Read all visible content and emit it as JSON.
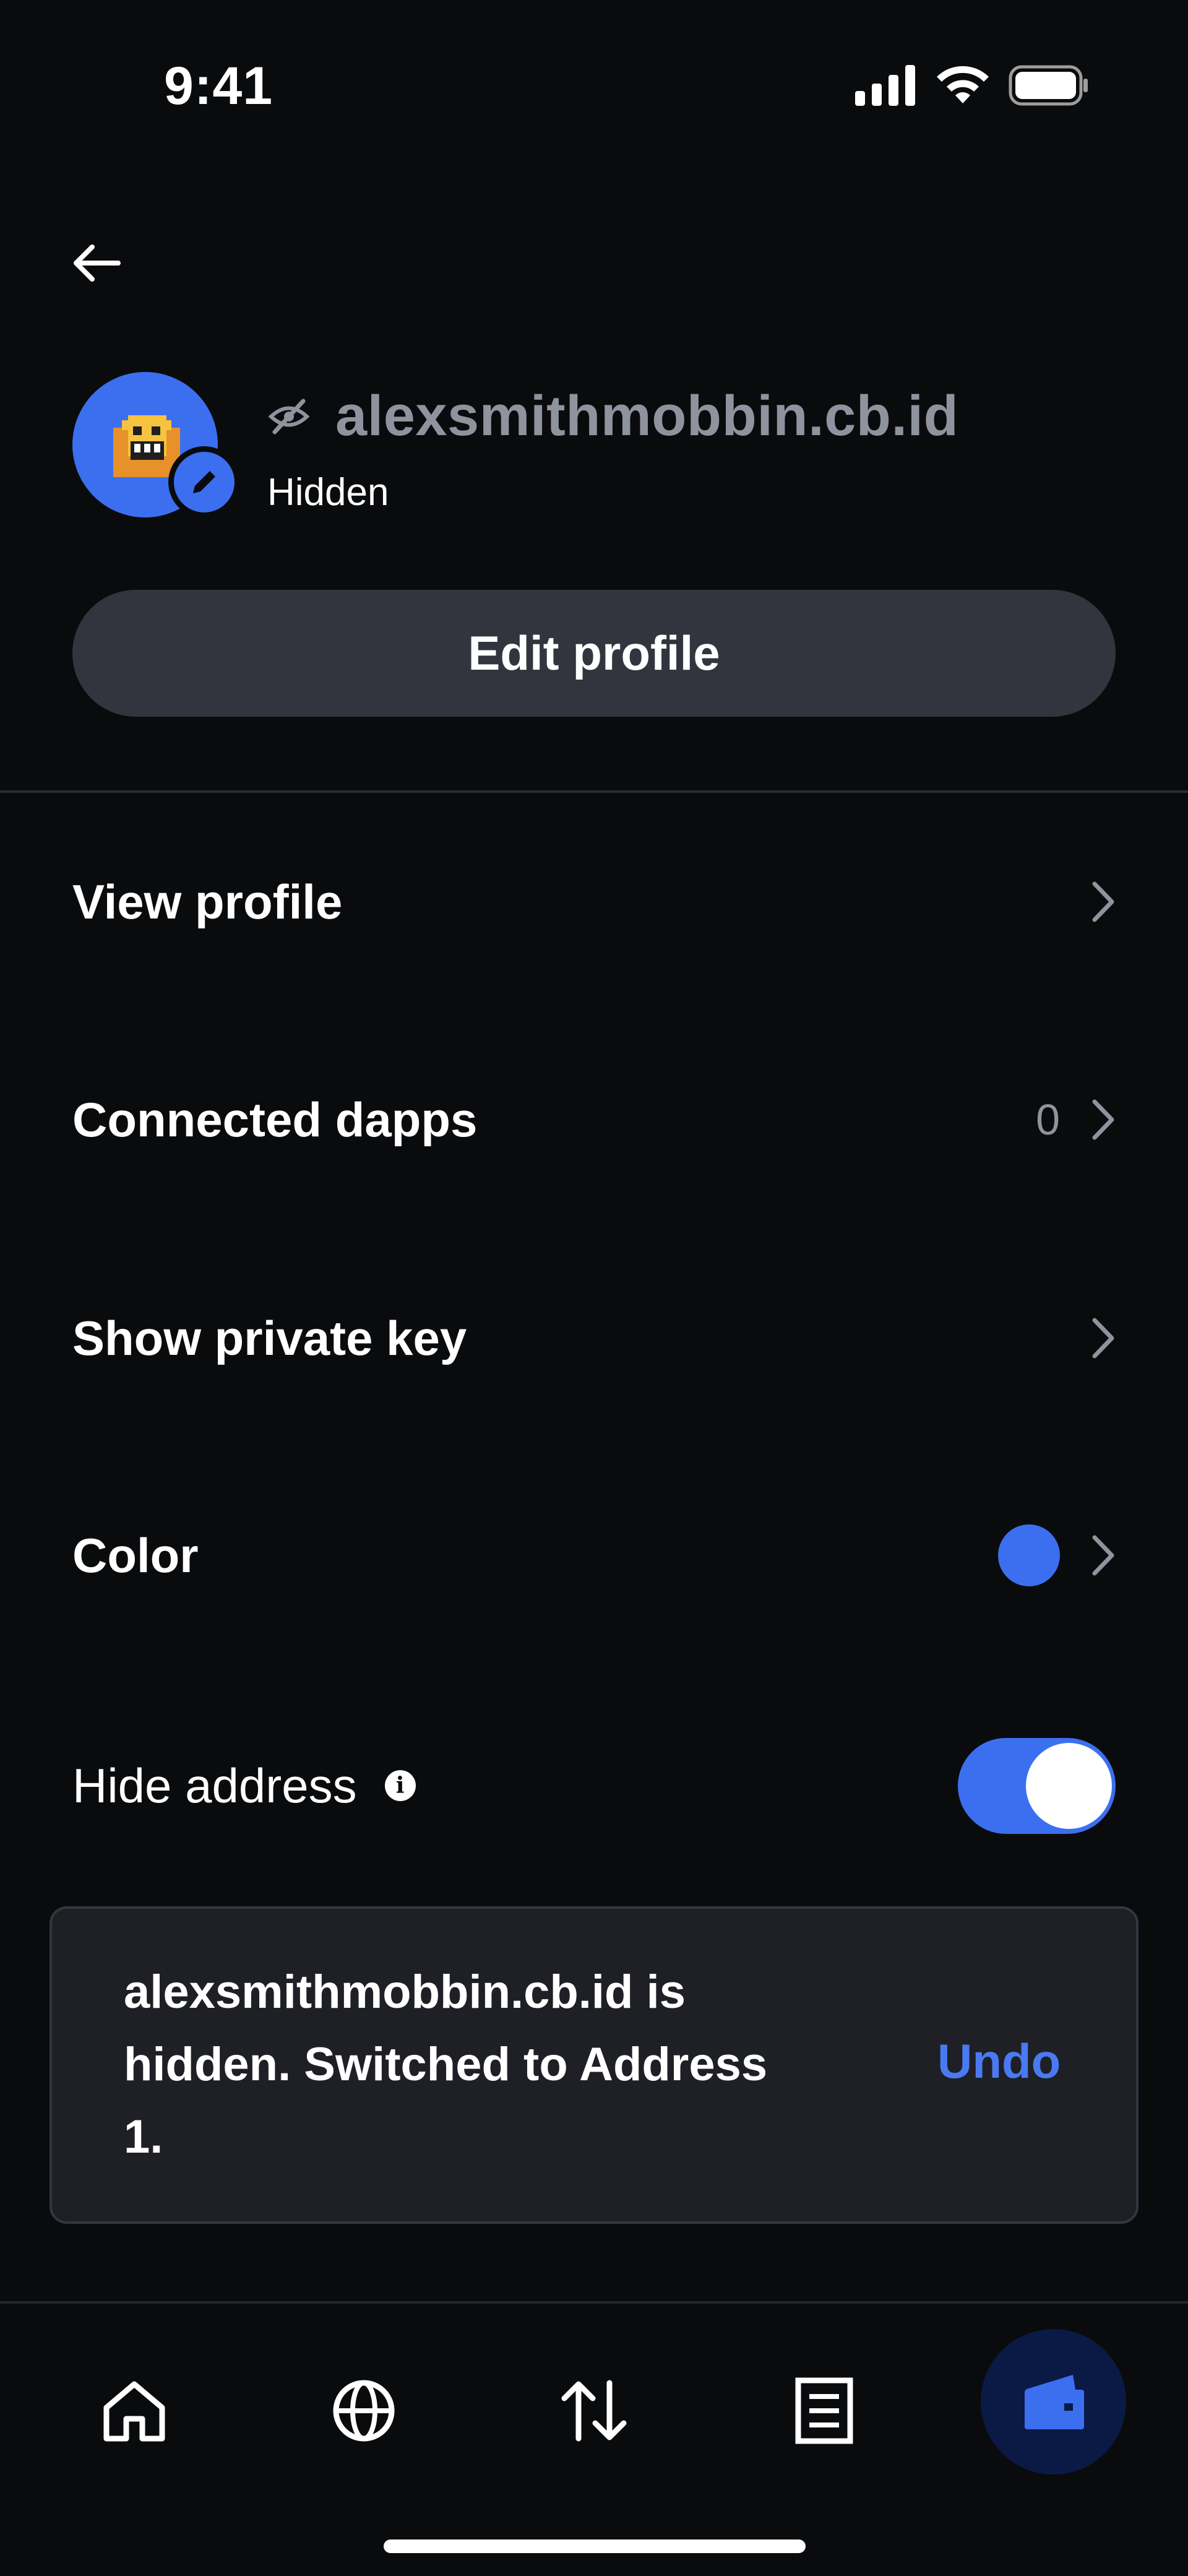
{
  "status_bar": {
    "time": "9:41"
  },
  "header": {
    "back_icon": "arrow-left-icon"
  },
  "profile": {
    "name": "alexsmithmobbin.cb.id",
    "visibility": "Hidden",
    "avatar_color": "#3C6FF0"
  },
  "edit_profile_label": "Edit profile",
  "settings": {
    "view_profile": "View profile",
    "connected_dapps": "Connected dapps",
    "connected_dapps_count": "0",
    "show_private_key": "Show private key",
    "color": "Color",
    "color_value": "#3C6FF0",
    "hide_address": "Hide address",
    "hide_address_enabled": true
  },
  "toast": {
    "message": "alexsmithmobbin.cb.id is hidden. Switched to Address 1.",
    "action": "Undo"
  },
  "tab_bar": {
    "tabs": [
      "home-icon",
      "globe-icon",
      "transfer-icon",
      "document-icon",
      "wallet-icon"
    ],
    "active": "wallet-icon"
  },
  "colors": {
    "background": "#0A0B0D",
    "accent": "#3C6FF0",
    "surface": "#32353D",
    "muted_text": "#8E939E"
  }
}
